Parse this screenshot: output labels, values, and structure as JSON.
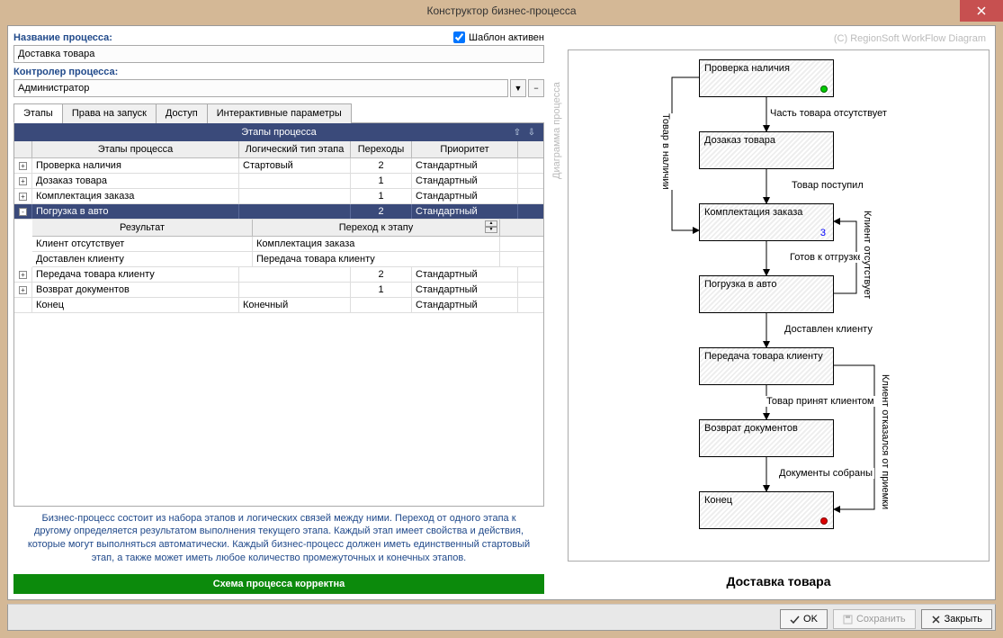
{
  "window": {
    "title": "Конструктор бизнес-процесса"
  },
  "form": {
    "process_name_label": "Название процесса:",
    "process_name_value": "Доставка товара",
    "template_active_label": "Шаблон активен",
    "controller_label": "Контролер процесса:",
    "controller_value": "Администратор"
  },
  "tabs": {
    "stages": "Этапы",
    "rights": "Права на запуск",
    "access": "Доступ",
    "params": "Интерактивные параметры"
  },
  "grid": {
    "title": "Этапы процесса",
    "cols": {
      "stage": "Этапы процесса",
      "logic": "Логический тип этапа",
      "trans": "Переходы",
      "prio": "Приоритет"
    },
    "sub_cols": {
      "result": "Результат",
      "goto": "Переход к этапу"
    },
    "rows": [
      {
        "stage": "Проверка наличия",
        "logic": "Стартовый",
        "trans": "2",
        "prio": "Стандартный",
        "exp": "+"
      },
      {
        "stage": "Дозаказ товара",
        "logic": "",
        "trans": "1",
        "prio": "Стандартный",
        "exp": "+"
      },
      {
        "stage": "Комплектация заказа",
        "logic": "",
        "trans": "1",
        "prio": "Стандартный",
        "exp": "+"
      },
      {
        "stage": "Погрузка в авто",
        "logic": "",
        "trans": "2",
        "prio": "Стандартный",
        "exp": "-",
        "selected": true
      },
      {
        "stage": "Передача товара клиенту",
        "logic": "",
        "trans": "2",
        "prio": "Стандартный",
        "exp": "+"
      },
      {
        "stage": "Возврат документов",
        "logic": "",
        "trans": "1",
        "prio": "Стандартный",
        "exp": "+"
      },
      {
        "stage": "Конец",
        "logic": "Конечный",
        "trans": "",
        "prio": "Стандартный",
        "exp": ""
      }
    ],
    "sub_rows": [
      {
        "result": "Клиент отсутствует",
        "goto": "Комплектация заказа"
      },
      {
        "result": "Доставлен клиенту",
        "goto": "Передача товара клиенту"
      }
    ]
  },
  "info": "Бизнес-процесс состоит из набора этапов и логических связей между ними. Переход от одного этапа к другому определяется результатом выполнения текущего этапа. Каждый этап имеет свойства и действия, которые могут выполняться автоматически. Каждый бизнес-процесс должен иметь единственный стартовый этап, а также может иметь любое количество промежуточных и конечных этапов.",
  "status": "Схема процесса корректна",
  "divider": "Диаграмма процесса",
  "copyright": "(C) RegionSoft WorkFlow Diagram",
  "diagram": {
    "title": "Доставка товара",
    "nodes": {
      "n1": "Проверка наличия",
      "n2": "Дозаказ товара",
      "n3": "Комплектация заказа",
      "n4": "Погрузка в авто",
      "n5": "Передача товара клиенту",
      "n6": "Возврат документов",
      "n7": "Конец"
    },
    "labels": {
      "e1": "Товар в наличии",
      "e2": "Часть товара отсутствует",
      "e3": "Товар поступил",
      "e4": "Готов к отгрузке",
      "e5": "Клиент отсутствует",
      "e6": "Доставлен клиенту",
      "e7": "Товар принят клиентом",
      "e8": "Клиент отказался от приемки",
      "e9": "Документы собраны"
    },
    "num3": "3"
  },
  "buttons": {
    "ok": "OK",
    "save": "Сохранить",
    "close": "Закрыть"
  }
}
